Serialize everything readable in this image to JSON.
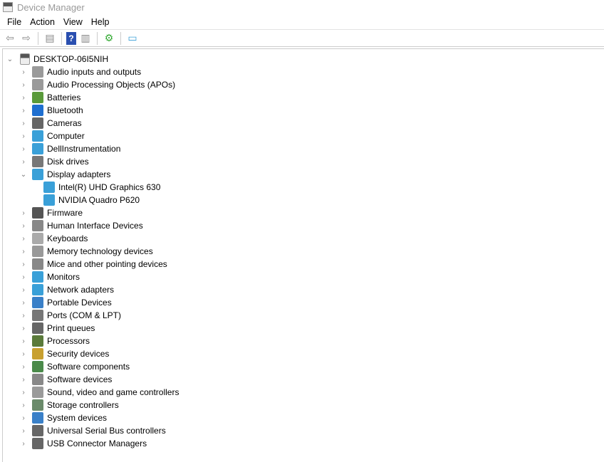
{
  "window": {
    "title": "Device Manager"
  },
  "menu": [
    "File",
    "Action",
    "View",
    "Help"
  ],
  "toolbar": [
    {
      "icon": "back-arrow-icon"
    },
    {
      "icon": "forward-arrow-icon"
    },
    {
      "icon": "show-hide-console-tree-icon"
    },
    {
      "icon": "help-icon"
    },
    {
      "icon": "show-action-pane-icon"
    },
    {
      "icon": "update-driver-icon"
    },
    {
      "icon": "scan-hardware-changes-icon"
    }
  ],
  "tree": {
    "root": "DESKTOP-06I5NIH",
    "items": [
      {
        "label": "Audio inputs and outputs",
        "color": "#9a9a9a"
      },
      {
        "label": "Audio Processing Objects (APOs)",
        "color": "#9a9a9a"
      },
      {
        "label": "Batteries",
        "color": "#5a9a3a"
      },
      {
        "label": "Bluetooth",
        "color": "#1f6fd0"
      },
      {
        "label": "Cameras",
        "color": "#666666"
      },
      {
        "label": "Computer",
        "color": "#3aa0d8"
      },
      {
        "label": "DellInstrumentation",
        "color": "#3aa0d8"
      },
      {
        "label": "Disk drives",
        "color": "#777777"
      },
      {
        "label": "Display adapters",
        "color": "#3aa0d8",
        "expanded": true,
        "children": [
          "Intel(R) UHD Graphics 630",
          "NVIDIA Quadro P620"
        ]
      },
      {
        "label": "Firmware",
        "color": "#555555"
      },
      {
        "label": "Human Interface Devices",
        "color": "#888888"
      },
      {
        "label": "Keyboards",
        "color": "#aaaaaa"
      },
      {
        "label": "Memory technology devices",
        "color": "#999999"
      },
      {
        "label": "Mice and other pointing devices",
        "color": "#888888"
      },
      {
        "label": "Monitors",
        "color": "#3aa0d8"
      },
      {
        "label": "Network adapters",
        "color": "#3aa0d8"
      },
      {
        "label": "Portable Devices",
        "color": "#3a80c8"
      },
      {
        "label": "Ports (COM & LPT)",
        "color": "#777777"
      },
      {
        "label": "Print queues",
        "color": "#666666"
      },
      {
        "label": "Processors",
        "color": "#5a7a3a"
      },
      {
        "label": "Security devices",
        "color": "#c8a030"
      },
      {
        "label": "Software components",
        "color": "#4a8a4a"
      },
      {
        "label": "Software devices",
        "color": "#888888"
      },
      {
        "label": "Sound, video and game controllers",
        "color": "#9a9a9a"
      },
      {
        "label": "Storage controllers",
        "color": "#6a8a6a"
      },
      {
        "label": "System devices",
        "color": "#3a80c8"
      },
      {
        "label": "Universal Serial Bus controllers",
        "color": "#666666"
      },
      {
        "label": "USB Connector Managers",
        "color": "#666666"
      }
    ]
  }
}
